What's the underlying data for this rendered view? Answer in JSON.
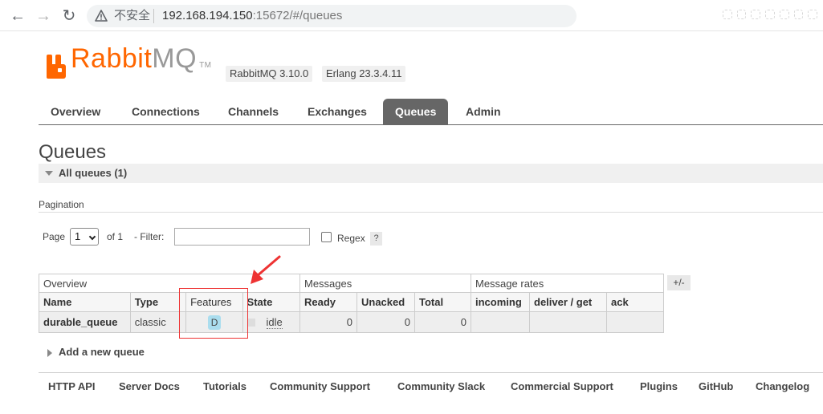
{
  "browser": {
    "insecure_label": "不安全",
    "url_host": "192.168.194.150",
    "url_rest": ":15672/#/queues"
  },
  "header": {
    "logo_rabbit": "Rabbit",
    "logo_mq": "MQ",
    "logo_tm": "TM",
    "rabbitmq_version": "RabbitMQ 3.10.0",
    "erlang_version": "Erlang 23.3.4.11"
  },
  "tabs": [
    {
      "label": "Overview"
    },
    {
      "label": "Connections"
    },
    {
      "label": "Channels"
    },
    {
      "label": "Exchanges"
    },
    {
      "label": "Queues",
      "active": true
    },
    {
      "label": "Admin"
    }
  ],
  "page": {
    "title": "Queues",
    "section_title": "All queues (1)",
    "pagination_label": "Pagination",
    "page_label": "Page",
    "page_value": "1",
    "of_label": "of 1",
    "filter_label": "- Filter:",
    "filter_value": "",
    "regex_label": "Regex",
    "help_label": "?"
  },
  "table": {
    "groups": {
      "overview": "Overview",
      "messages": "Messages",
      "message_rates": "Message rates",
      "toggle": "+/-"
    },
    "columns": {
      "name": "Name",
      "type": "Type",
      "features": "Features",
      "state": "State",
      "ready": "Ready",
      "unacked": "Unacked",
      "total": "Total",
      "incoming": "incoming",
      "deliver_get": "deliver / get",
      "ack": "ack"
    },
    "rows": [
      {
        "name": "durable_queue",
        "type": "classic",
        "features": "D",
        "state": "idle",
        "ready": "0",
        "unacked": "0",
        "total": "0",
        "incoming": "",
        "deliver_get": "",
        "ack": ""
      }
    ]
  },
  "add_queue_label": "Add a new queue",
  "footer": [
    {
      "label": "HTTP API"
    },
    {
      "label": "Server Docs"
    },
    {
      "label": "Tutorials"
    },
    {
      "label": "Community Support"
    },
    {
      "label": "Community Slack"
    },
    {
      "label": "Commercial Support"
    },
    {
      "label": "Plugins"
    },
    {
      "label": "GitHub"
    },
    {
      "label": "Changelog"
    }
  ],
  "colors": {
    "brand_orange": "#ff6600",
    "tab_active_bg": "#666666",
    "feature_badge": "#aaddee",
    "annotation_red": "#ee3333"
  }
}
